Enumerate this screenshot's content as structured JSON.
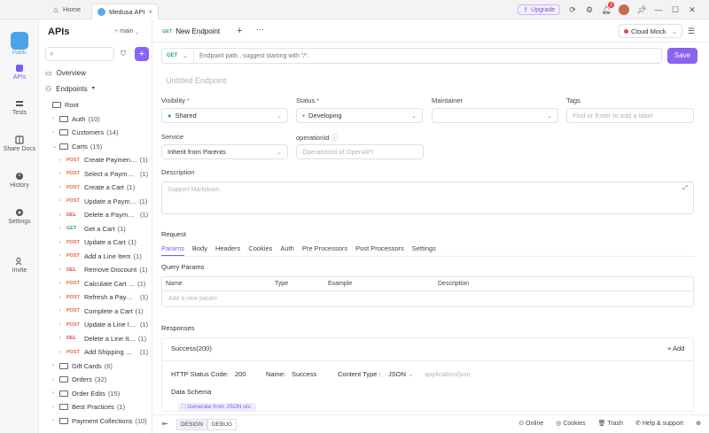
{
  "titlebar": {
    "home": "Home",
    "tab": "Medusa API",
    "upgrade": "Upgrade",
    "notifications": "3"
  },
  "rail": {
    "public": "Public",
    "items": [
      "APIs",
      "Tests",
      "Share Docs",
      "History",
      "Settings",
      "Invite"
    ]
  },
  "sidebar": {
    "title": "APIs",
    "branch": "main",
    "overview": "Overview",
    "endpoints": "Endpoints",
    "root": "Root",
    "folders_top": [
      {
        "name": "Auth",
        "count": "(10)"
      },
      {
        "name": "Customers",
        "count": "(14)"
      },
      {
        "name": "Carts",
        "count": "(15)"
      }
    ],
    "cart_endpoints": [
      {
        "method": "POST",
        "name": "Create Paymen…",
        "count": "(1)"
      },
      {
        "method": "POST",
        "name": "Select a Payme…",
        "count": "(1)"
      },
      {
        "method": "POST",
        "name": "Create a Cart",
        "count": "(1)"
      },
      {
        "method": "POST",
        "name": "Update a Paym…",
        "count": "(1)"
      },
      {
        "method": "DEL",
        "name": "Delete a Payme…",
        "count": "(1)"
      },
      {
        "method": "GET",
        "name": "Get a Cart",
        "count": "(1)"
      },
      {
        "method": "POST",
        "name": "Update a Cart",
        "count": "(1)"
      },
      {
        "method": "POST",
        "name": "Add a Line Item",
        "count": "(1)"
      },
      {
        "method": "DEL",
        "name": "Remove Discount",
        "count": "(1)"
      },
      {
        "method": "POST",
        "name": "Calculate Cart …",
        "count": "(1)"
      },
      {
        "method": "POST",
        "name": "Refresh a Paym…",
        "count": "(1)"
      },
      {
        "method": "POST",
        "name": "Complete a Cart",
        "count": "(1)"
      },
      {
        "method": "POST",
        "name": "Update a Line It…",
        "count": "(1)"
      },
      {
        "method": "DEL",
        "name": "Delete a Line It…",
        "count": "(1)"
      },
      {
        "method": "POST",
        "name": "Add Shipping M…",
        "count": "(1)"
      }
    ],
    "folders_bottom": [
      {
        "name": "Gift Cards",
        "count": "(6)"
      },
      {
        "name": "Orders",
        "count": "(32)"
      },
      {
        "name": "Order Edits",
        "count": "(15)"
      },
      {
        "name": "Best Practices",
        "count": "(1)"
      },
      {
        "name": "Payment Collections",
        "count": "(10)"
      }
    ]
  },
  "main": {
    "tab_method": "GET",
    "tab_title": "New Endpoint",
    "cloud_mock": "Cloud Mock",
    "url_method": "GET",
    "url_placeholder": "Endpoint path , suggest starting with \"/\".",
    "save": "Save",
    "endpoint_title": "Untitled Endpoint",
    "visibility_label": "Visibility",
    "visibility_value": "Shared",
    "status_label": "Status",
    "status_value": "Developing",
    "maintainer_label": "Maintainer",
    "tags_label": "Tags",
    "tags_placeholder": "Find or Enter to add a label",
    "service_label": "Service",
    "service_value": "Inherit from Parents",
    "operation_label": "operationId",
    "operation_placeholder": "OperationId of OpenAPI",
    "description_label": "Description",
    "description_placeholder": "Support Markdown",
    "request_label": "Request",
    "request_tabs": [
      "Params",
      "Body",
      "Headers",
      "Cookies",
      "Auth",
      "Pre Processors",
      "Post Processors",
      "Settings"
    ],
    "query_params_label": "Query Params",
    "query_columns": [
      "Name",
      "Type",
      "Example",
      "Description"
    ],
    "add_param": "Add a new param",
    "responses_label": "Responses",
    "response_tab": "Success(200)",
    "add": "+ Add",
    "http_status_label": "HTTP Status Code:",
    "http_status_value": "200",
    "name_label": "Name:",
    "name_value": "Success",
    "content_type_label": "Content Type :",
    "content_type_value": "JSON",
    "content_type_mime": "application/json",
    "data_schema": "Data Schema",
    "generate": "Generate from JSON etc."
  },
  "footer": {
    "design": "DESIGN",
    "debug": "DEBUG",
    "online": "Online",
    "cookies": "Cookies",
    "trash": "Trash",
    "help": "Help & support"
  },
  "colors": {
    "accent": "#8a63f0",
    "post": "#e8673c",
    "get": "#2aa66c",
    "del": "#e14b4b"
  }
}
